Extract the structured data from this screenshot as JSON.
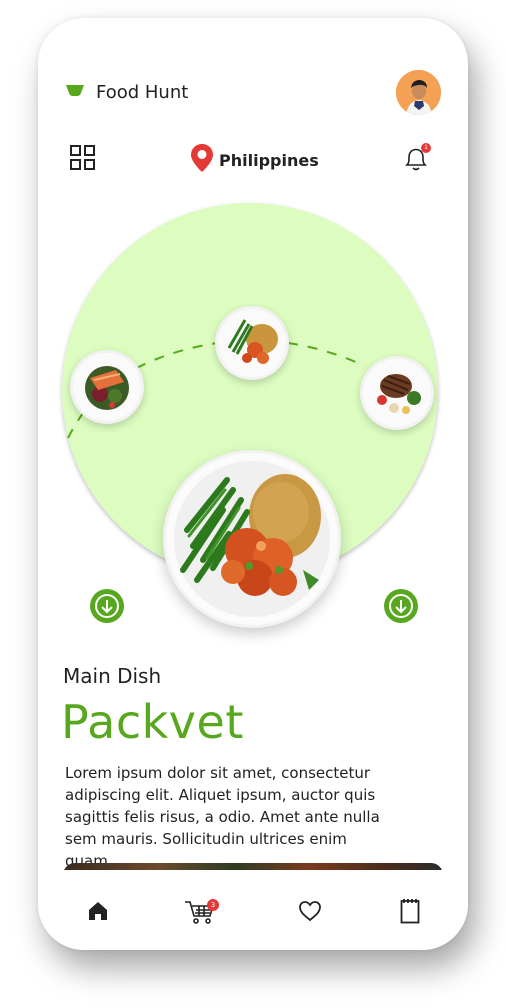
{
  "app": {
    "name": "Food Hunt"
  },
  "header": {
    "location": "Philippines",
    "notification_count": "1"
  },
  "carousel": {
    "selected_plate": "green beans with shrimp and rice",
    "side_plates": [
      "salmon salad",
      "green beans with shrimp and rice",
      "steak with vegetables"
    ]
  },
  "dish": {
    "category": "Main Dish",
    "name": "Packvet",
    "description": "Lorem ipsum dolor sit amet, consectetur adipiscing elit. Aliquet ipsum, auctor quis sagittis felis risus, a odio. Amet ante nulla sem mauris. Sollicitudin ultrices enim quam."
  },
  "tabbar": {
    "tabs": [
      "home",
      "cart",
      "favorites",
      "orders"
    ],
    "cart_count": "3"
  },
  "colors": {
    "accent": "#57a81e",
    "circle_bg": "#dcfcc0",
    "badge": "#e53935",
    "avatar_bg": "#f5a155"
  },
  "icons": [
    "bowl-logo-icon",
    "grid-menu-icon",
    "location-pin-icon",
    "bell-icon",
    "arrow-down-icon",
    "home-icon",
    "cart-icon",
    "heart-icon",
    "orders-icon"
  ]
}
